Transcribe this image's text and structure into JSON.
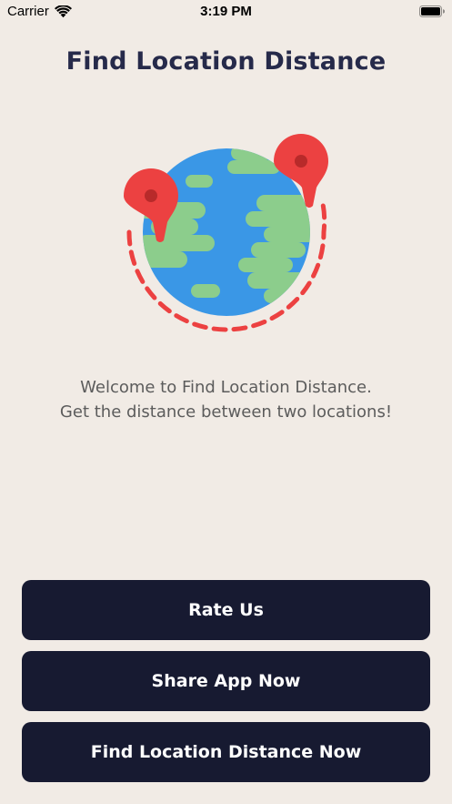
{
  "status_bar": {
    "carrier": "Carrier",
    "time": "3:19 PM",
    "icons": [
      "wifi-icon",
      "battery-icon"
    ]
  },
  "page": {
    "title": "Find Location Distance",
    "illustration": "globe-with-map-pins",
    "welcome_line_1": "Welcome to Find Location Distance.",
    "welcome_line_2": "Get the distance between two locations!"
  },
  "buttons": {
    "rate_label": "Rate Us",
    "share_label": "Share App Now",
    "find_label": "Find Location Distance Now"
  },
  "colors": {
    "background": "#f1ebe5",
    "title": "#262a4a",
    "button": "#171a31",
    "button_text": "#ffffff",
    "ocean": "#3a97e6",
    "land": "#8ccd8c",
    "pin": "#ec4141",
    "pin_dot": "#b82a2a"
  }
}
